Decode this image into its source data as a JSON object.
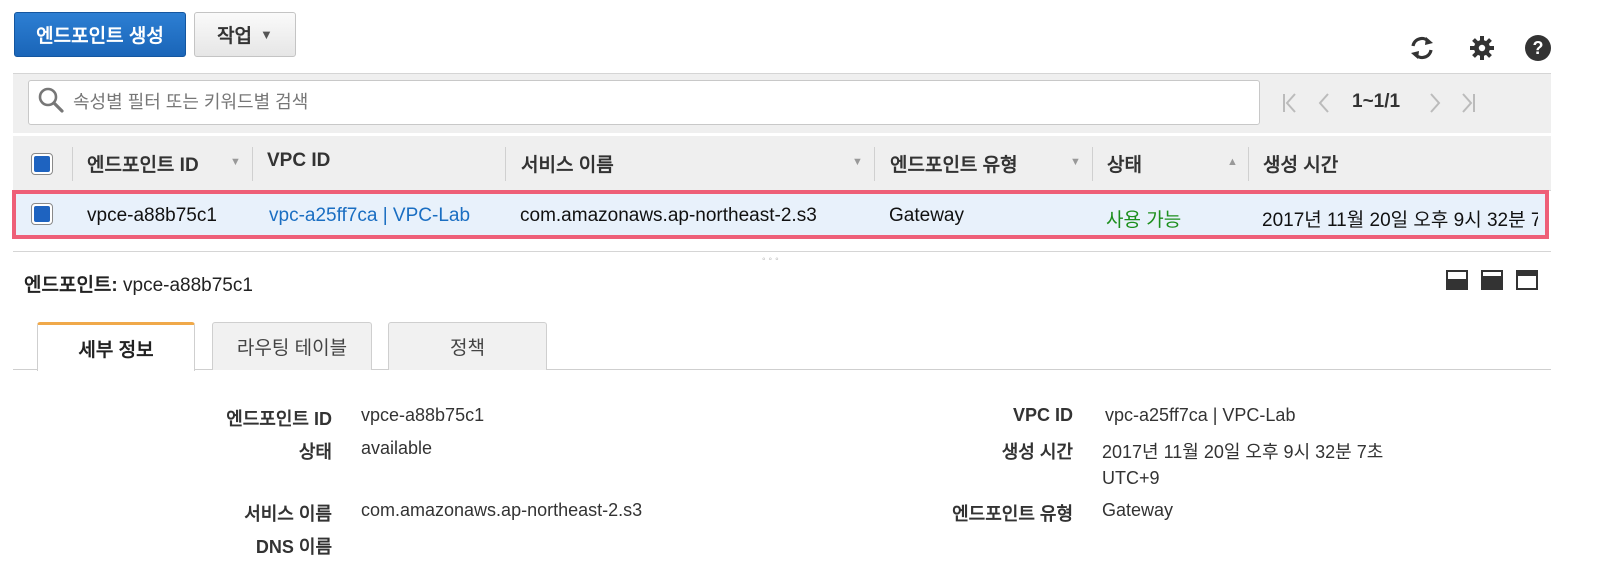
{
  "toolbar": {
    "create_label": "엔드포인트 생성",
    "actions_label": "작업"
  },
  "filter": {
    "placeholder": "속성별 필터 또는 키워드별 검색"
  },
  "pager": {
    "range": "1~1/1"
  },
  "table": {
    "headers": [
      "엔드포인트 ID",
      "VPC ID",
      "서비스 이름",
      "엔드포인트 유형",
      "상태",
      "생성 시간"
    ],
    "row": {
      "id": "vpce-a88b75c1",
      "vpc": "vpc-a25ff7ca | VPC-Lab",
      "service": "com.amazonaws.ap-northeast-2.s3",
      "type": "Gateway",
      "state": "사용 가능",
      "created": "2017년 11월 20일 오후 9시 32분 7"
    }
  },
  "detail": {
    "title_label": "엔드포인트:",
    "title_value": "vpce-a88b75c1",
    "tabs": [
      "세부 정보",
      "라우팅 테이블",
      "정책"
    ],
    "fields": {
      "id_label": "엔드포인트 ID",
      "id_value": "vpce-a88b75c1",
      "state_label": "상태",
      "state_value": "available",
      "service_label": "서비스 이름",
      "service_value": "com.amazonaws.ap-northeast-2.s3",
      "dns_label": "DNS 이름",
      "vpc_label": "VPC ID",
      "vpc_value": "vpc-a25ff7ca | VPC-Lab",
      "created_label": "생성 시간",
      "created_value_line1": "2017년 11월 20일 오후 9시 32분 7초",
      "created_value_line2": "UTC+9",
      "type_label": "엔드포인트 유형",
      "type_value": "Gateway"
    }
  },
  "icons": {
    "refresh": "refresh-icon",
    "settings": "gear-icon",
    "help": "help-icon",
    "search": "search-icon"
  },
  "colors": {
    "primary": "#1a65b8",
    "link": "#1a6ec2",
    "status_ok": "#1d8f1d",
    "selection_outline": "#ee5f78",
    "active_tab_accent": "#f0a94a"
  }
}
